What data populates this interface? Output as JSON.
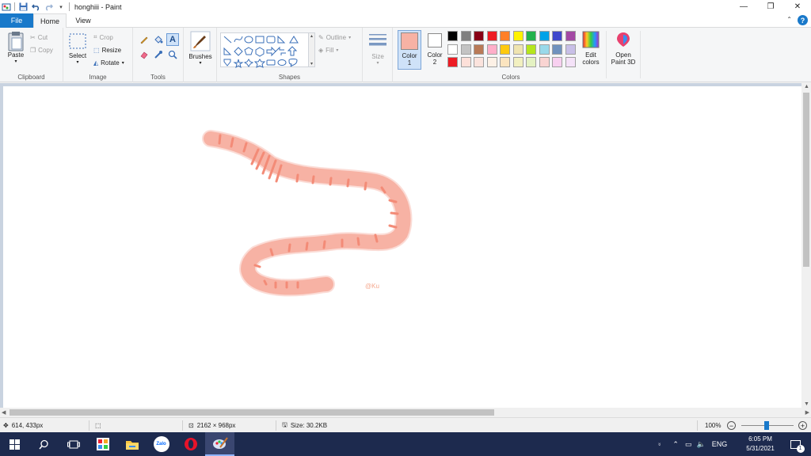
{
  "window": {
    "title": "honghiii - Paint",
    "controls": {
      "minimize": "—",
      "restore": "❐",
      "close": "✕"
    }
  },
  "quick_access": {
    "icons": [
      "paint-app-icon",
      "save-icon",
      "undo-icon",
      "redo-icon",
      "customize-qa-icon"
    ]
  },
  "menu": {
    "file": "File",
    "home": "Home",
    "view": "View"
  },
  "ribbon": {
    "clipboard": {
      "label": "Clipboard",
      "paste": "Paste",
      "cut": "Cut",
      "copy": "Copy"
    },
    "image": {
      "label": "Image",
      "select": "Select",
      "crop": "Crop",
      "resize": "Resize",
      "rotate": "Rotate"
    },
    "tools": {
      "label": "Tools"
    },
    "brushes": {
      "label": "Brushes"
    },
    "shapes": {
      "label": "Shapes",
      "outline": "Outline",
      "fill": "Fill"
    },
    "size": {
      "label": "Size"
    },
    "color1": {
      "label1": "Color",
      "label2": "1",
      "value": "#f7b2a4"
    },
    "color2": {
      "label1": "Color",
      "label2": "2",
      "value": "#ffffff"
    },
    "colors": {
      "label": "Colors",
      "palette_row1": [
        "#000000",
        "#7f7f7f",
        "#880015",
        "#ed1c24",
        "#ff7f27",
        "#fff200",
        "#22b14c",
        "#00a2e8",
        "#3f48cc",
        "#a349a4"
      ],
      "palette_row2": [
        "#ffffff",
        "#c3c3c3",
        "#b97a57",
        "#ffaec9",
        "#ffc90e",
        "#efe4b0",
        "#b5e61d",
        "#99d9ea",
        "#7092be",
        "#c8bfe7"
      ],
      "palette_row3": [
        "#ed1c24",
        "#fde0d9",
        "#fbe3dd",
        "#fdf1e6",
        "#fbe4bf",
        "#f2f0c0",
        "#e4f2c2",
        "#f9d4d2",
        "#f8d0f0",
        "#f4e2f8"
      ],
      "edit_label1": "Edit",
      "edit_label2": "colors"
    },
    "paint3d": {
      "label1": "Open",
      "label2": "Paint 3D"
    }
  },
  "canvas": {
    "signature": "@Ku",
    "worm_color": "#f7b2a4",
    "worm_stripe": "#f38b77"
  },
  "status": {
    "cursor": "614, 433px",
    "dimensions": "2162 × 968px",
    "size": "Size: 30.2KB",
    "zoom": "100%",
    "zoom_minus": "−",
    "zoom_plus": "+"
  },
  "taskbar": {
    "apps": [
      "start-icon",
      "search-icon",
      "task-view-icon",
      "app-grid-icon",
      "file-explorer-icon",
      "zalo-icon",
      "opera-icon",
      "paint-icon"
    ],
    "zalo": "Zalo",
    "lang": "ENG",
    "time": "6:05 PM",
    "date": "5/31/2021",
    "notif_count": "1"
  }
}
